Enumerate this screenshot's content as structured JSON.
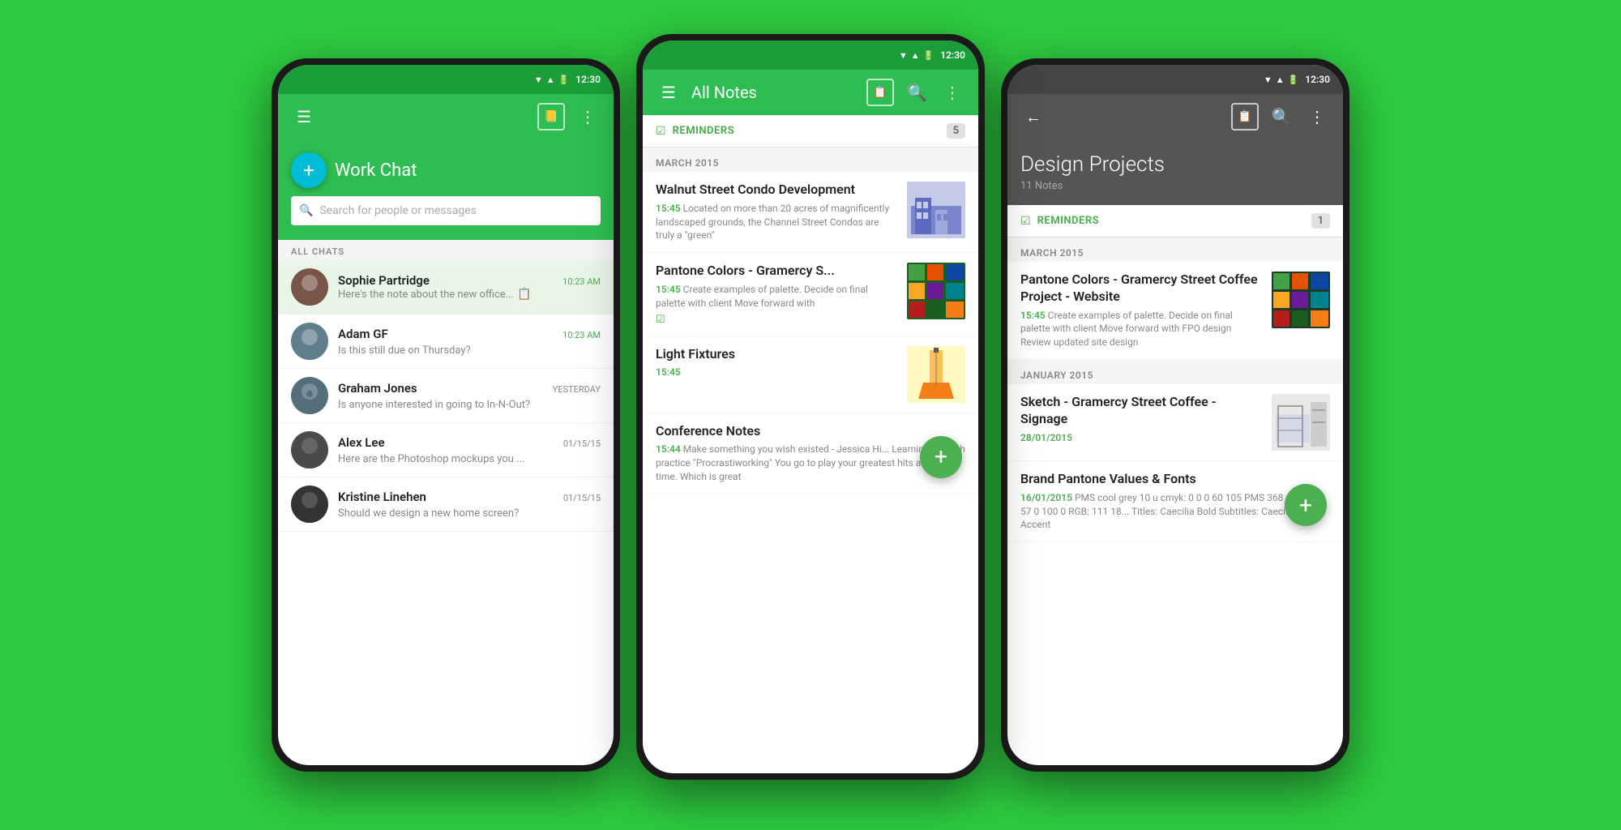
{
  "background": "#2ecc40",
  "phone1": {
    "statusBar": {
      "time": "12:30",
      "bgColor": "#1b9e3a"
    },
    "toolbar": {
      "menuIcon": "☰",
      "notebookIcon": "📒",
      "moreIcon": "⋮"
    },
    "header": {
      "fabIcon": "+",
      "title": "Work Chat"
    },
    "search": {
      "placeholder": "Search for people or messages"
    },
    "sectionLabel": "ALL CHATS",
    "chats": [
      {
        "name": "Sophie Partridge",
        "time": "10:23 AM",
        "msg": "Here's the note about the new office...",
        "avatarColor": "#795548",
        "active": true,
        "hasAttach": true
      },
      {
        "name": "Adam GF",
        "time": "10:23 AM",
        "msg": "Is this still due on Thursday?",
        "avatarColor": "#607d8b",
        "active": false,
        "hasAttach": false
      },
      {
        "name": "Graham Jones",
        "time": "YESTERDAY",
        "msg": "Is anyone interested in going to In-N-Out?",
        "avatarColor": "#546e7a",
        "active": false,
        "hasAttach": false
      },
      {
        "name": "Alex Lee",
        "time": "01/15/15",
        "msg": "Here are the Photoshop mockups you ...",
        "avatarColor": "#4a4a4a",
        "active": false,
        "hasAttach": false
      },
      {
        "name": "Kristine Linehen",
        "time": "01/15/15",
        "msg": "Should we design a new home screen?",
        "avatarColor": "#333",
        "active": false,
        "hasAttach": false
      }
    ]
  },
  "phone2": {
    "statusBar": {
      "time": "12:30",
      "bgColor": "#1b9e3a"
    },
    "toolbar": {
      "menuIcon": "☰",
      "title": "All Notes",
      "noteIcon": "📋",
      "searchIcon": "🔍",
      "moreIcon": "⋮"
    },
    "remindersCount": "5",
    "sections": [
      {
        "label": "MARCH 2015",
        "notes": [
          {
            "title": "Walnut Street Condo Development",
            "time": "15:45",
            "preview": "Located on more than 20 acres of magnificently landscaped grounds, the Channel Street Condos are truly a \"green\"",
            "thumb": "condo"
          },
          {
            "title": "Pantone Colors - Gramercy S...",
            "time": "15:45",
            "preview": "Create examples of palette.  Decide on final palette with client Move forward with",
            "thumb": "pantone",
            "hasReminder": true
          },
          {
            "title": "Light Fixtures",
            "time": "15:45",
            "preview": "",
            "thumb": "fixture"
          }
        ]
      },
      {
        "label": "",
        "notes": [
          {
            "title": "Conference Notes",
            "time": "15:44",
            "preview": "Make something you wish existed - Jessica Hi... Learning through practice \"Procrastiworking\" You go to play  your greatest hits all the time.  Which is great",
            "thumb": null
          }
        ]
      }
    ],
    "fab": "+"
  },
  "phone3": {
    "statusBar": {
      "time": "12:30",
      "bgColor": "#444"
    },
    "toolbar": {
      "backIcon": "←",
      "noteIcon": "📋",
      "searchIcon": "🔍",
      "moreIcon": "⋮"
    },
    "header": {
      "title": "Design Projects",
      "subtitle": "11 Notes"
    },
    "remindersCount": "1",
    "sections": [
      {
        "label": "MARCH 2015",
        "notes": [
          {
            "title": "Pantone Colors - Gramercy Street Coffee Project - Website",
            "time": "15:45",
            "preview": "Create examples of palette. Decide on final palette with client Move forward with FPO design Review updated site design",
            "thumb": "pantone-dp"
          }
        ]
      },
      {
        "label": "JANUARY 2015",
        "notes": [
          {
            "title": "Sketch - Gramercy Street Coffee - Signage",
            "time": "28/01/2015",
            "preview": "",
            "thumb": "sketch",
            "timeColor": "#4caf50"
          },
          {
            "title": "Brand Pantone Values & Fonts",
            "time": "16/01/2015",
            "preview": "PMS cool grey 10 u  cmyk: 0 0 0 60  105  PMS 368 u  CMYK: 57 0 100 0  RGB: 111 18... Titles: Caecilia Bold  Subtitles: Caecilia Light  Accent",
            "thumb": null,
            "timeColor": "#4caf50"
          }
        ]
      }
    ],
    "fab": "+"
  }
}
